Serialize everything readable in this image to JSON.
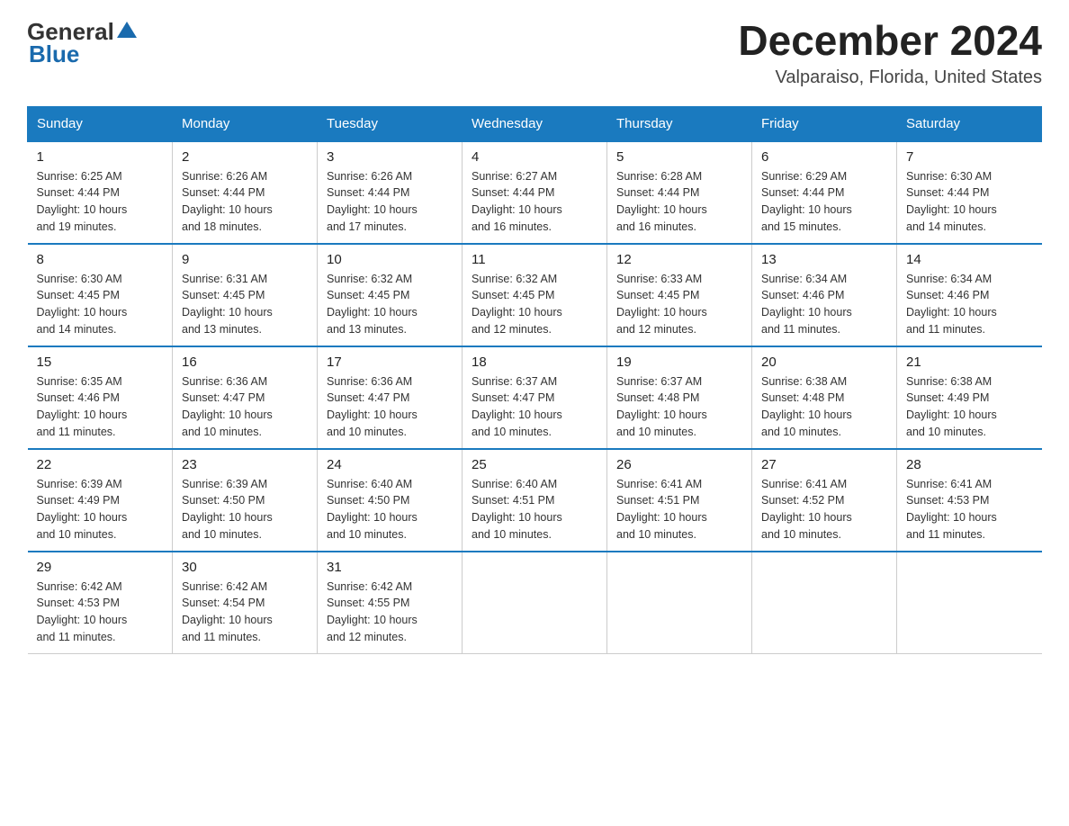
{
  "header": {
    "title": "December 2024",
    "subtitle": "Valparaiso, Florida, United States",
    "logo_general": "General",
    "logo_blue": "Blue"
  },
  "weekdays": [
    "Sunday",
    "Monday",
    "Tuesday",
    "Wednesday",
    "Thursday",
    "Friday",
    "Saturday"
  ],
  "weeks": [
    [
      {
        "day": "1",
        "sunrise": "6:25 AM",
        "sunset": "4:44 PM",
        "daylight": "10 hours and 19 minutes."
      },
      {
        "day": "2",
        "sunrise": "6:26 AM",
        "sunset": "4:44 PM",
        "daylight": "10 hours and 18 minutes."
      },
      {
        "day": "3",
        "sunrise": "6:26 AM",
        "sunset": "4:44 PM",
        "daylight": "10 hours and 17 minutes."
      },
      {
        "day": "4",
        "sunrise": "6:27 AM",
        "sunset": "4:44 PM",
        "daylight": "10 hours and 16 minutes."
      },
      {
        "day": "5",
        "sunrise": "6:28 AM",
        "sunset": "4:44 PM",
        "daylight": "10 hours and 16 minutes."
      },
      {
        "day": "6",
        "sunrise": "6:29 AM",
        "sunset": "4:44 PM",
        "daylight": "10 hours and 15 minutes."
      },
      {
        "day": "7",
        "sunrise": "6:30 AM",
        "sunset": "4:44 PM",
        "daylight": "10 hours and 14 minutes."
      }
    ],
    [
      {
        "day": "8",
        "sunrise": "6:30 AM",
        "sunset": "4:45 PM",
        "daylight": "10 hours and 14 minutes."
      },
      {
        "day": "9",
        "sunrise": "6:31 AM",
        "sunset": "4:45 PM",
        "daylight": "10 hours and 13 minutes."
      },
      {
        "day": "10",
        "sunrise": "6:32 AM",
        "sunset": "4:45 PM",
        "daylight": "10 hours and 13 minutes."
      },
      {
        "day": "11",
        "sunrise": "6:32 AM",
        "sunset": "4:45 PM",
        "daylight": "10 hours and 12 minutes."
      },
      {
        "day": "12",
        "sunrise": "6:33 AM",
        "sunset": "4:45 PM",
        "daylight": "10 hours and 12 minutes."
      },
      {
        "day": "13",
        "sunrise": "6:34 AM",
        "sunset": "4:46 PM",
        "daylight": "10 hours and 11 minutes."
      },
      {
        "day": "14",
        "sunrise": "6:34 AM",
        "sunset": "4:46 PM",
        "daylight": "10 hours and 11 minutes."
      }
    ],
    [
      {
        "day": "15",
        "sunrise": "6:35 AM",
        "sunset": "4:46 PM",
        "daylight": "10 hours and 11 minutes."
      },
      {
        "day": "16",
        "sunrise": "6:36 AM",
        "sunset": "4:47 PM",
        "daylight": "10 hours and 10 minutes."
      },
      {
        "day": "17",
        "sunrise": "6:36 AM",
        "sunset": "4:47 PM",
        "daylight": "10 hours and 10 minutes."
      },
      {
        "day": "18",
        "sunrise": "6:37 AM",
        "sunset": "4:47 PM",
        "daylight": "10 hours and 10 minutes."
      },
      {
        "day": "19",
        "sunrise": "6:37 AM",
        "sunset": "4:48 PM",
        "daylight": "10 hours and 10 minutes."
      },
      {
        "day": "20",
        "sunrise": "6:38 AM",
        "sunset": "4:48 PM",
        "daylight": "10 hours and 10 minutes."
      },
      {
        "day": "21",
        "sunrise": "6:38 AM",
        "sunset": "4:49 PM",
        "daylight": "10 hours and 10 minutes."
      }
    ],
    [
      {
        "day": "22",
        "sunrise": "6:39 AM",
        "sunset": "4:49 PM",
        "daylight": "10 hours and 10 minutes."
      },
      {
        "day": "23",
        "sunrise": "6:39 AM",
        "sunset": "4:50 PM",
        "daylight": "10 hours and 10 minutes."
      },
      {
        "day": "24",
        "sunrise": "6:40 AM",
        "sunset": "4:50 PM",
        "daylight": "10 hours and 10 minutes."
      },
      {
        "day": "25",
        "sunrise": "6:40 AM",
        "sunset": "4:51 PM",
        "daylight": "10 hours and 10 minutes."
      },
      {
        "day": "26",
        "sunrise": "6:41 AM",
        "sunset": "4:51 PM",
        "daylight": "10 hours and 10 minutes."
      },
      {
        "day": "27",
        "sunrise": "6:41 AM",
        "sunset": "4:52 PM",
        "daylight": "10 hours and 10 minutes."
      },
      {
        "day": "28",
        "sunrise": "6:41 AM",
        "sunset": "4:53 PM",
        "daylight": "10 hours and 11 minutes."
      }
    ],
    [
      {
        "day": "29",
        "sunrise": "6:42 AM",
        "sunset": "4:53 PM",
        "daylight": "10 hours and 11 minutes."
      },
      {
        "day": "30",
        "sunrise": "6:42 AM",
        "sunset": "4:54 PM",
        "daylight": "10 hours and 11 minutes."
      },
      {
        "day": "31",
        "sunrise": "6:42 AM",
        "sunset": "4:55 PM",
        "daylight": "10 hours and 12 minutes."
      },
      null,
      null,
      null,
      null
    ]
  ],
  "labels": {
    "sunrise": "Sunrise:",
    "sunset": "Sunset:",
    "daylight": "Daylight:"
  }
}
